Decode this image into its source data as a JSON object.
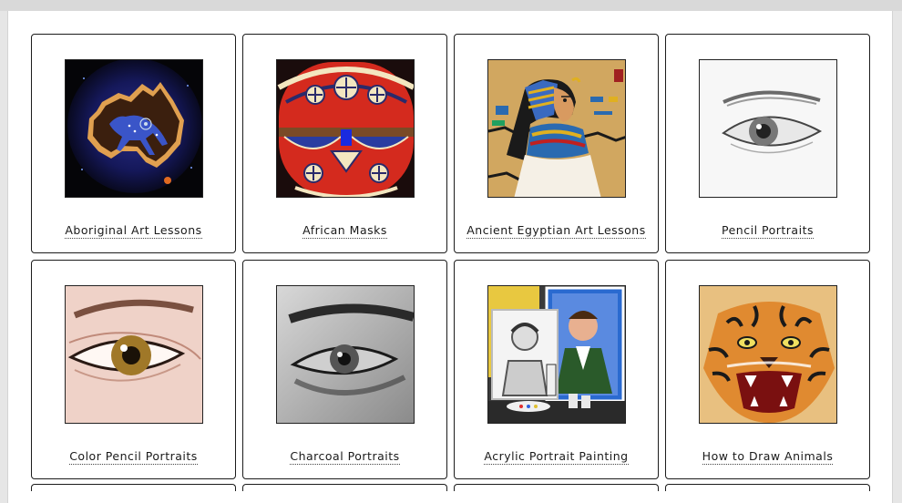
{
  "gallery": {
    "items": [
      {
        "label": "Aboriginal Art Lessons",
        "icon": "aboriginal-kangaroo-art"
      },
      {
        "label": "African Masks",
        "icon": "african-mask-art"
      },
      {
        "label": "Ancient Egyptian Art Lessons",
        "icon": "egyptian-pharaoh-art"
      },
      {
        "label": "Pencil Portraits",
        "icon": "pencil-eye-drawing"
      },
      {
        "label": "Color Pencil Portraits",
        "icon": "color-pencil-eye-drawing"
      },
      {
        "label": "Charcoal Portraits",
        "icon": "charcoal-eye-drawing"
      },
      {
        "label": "Acrylic Portrait Painting",
        "icon": "acrylic-portrait-paintings"
      },
      {
        "label": "How to Draw Animals",
        "icon": "tiger-face-drawing"
      }
    ]
  }
}
